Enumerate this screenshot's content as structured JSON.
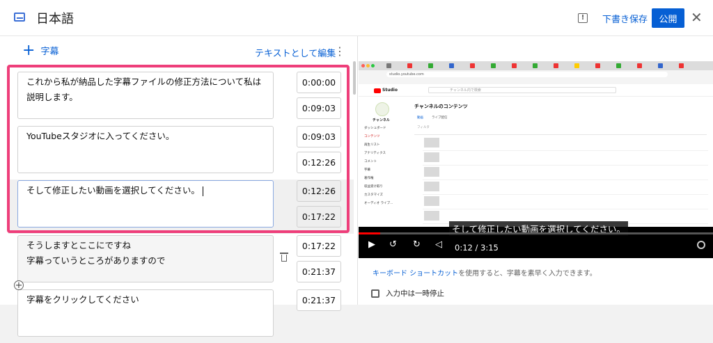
{
  "header": {
    "title": "日本語",
    "draft_label": "下書き保存",
    "publish_label": "公開",
    "close_glyph": "✕",
    "feedback_glyph": "!"
  },
  "editor": {
    "add_subtitle_label": "字幕",
    "edit_as_text_label": "テキストとして編集",
    "more_glyph": "⋮",
    "rows": [
      {
        "text": "これから私が納品した字幕ファイルの修正方法について私は説明します。",
        "start": "0:00:00",
        "end": "0:09:03"
      },
      {
        "text": "YouTubeスタジオに入ってください。",
        "start": "0:09:03",
        "end": "0:12:26"
      },
      {
        "text": "そして修正したい動画を選択してください。",
        "start": "0:12:26",
        "end": "0:17:22"
      },
      {
        "text": "そうしますとここにですね\n字幕っていうところがありますので",
        "start": "0:17:22",
        "end": "0:21:37"
      },
      {
        "text": "字幕をクリックしてください",
        "start": "0:21:37",
        "end": ""
      }
    ]
  },
  "preview": {
    "caption": "そして修正したい動画を選択してください。",
    "time_current": "0:12",
    "time_total": "3:15",
    "progress": 0.06,
    "studio": {
      "logo_text": "Studio",
      "search_placeholder": "チャンネル内で検索",
      "page_title": "チャンネルのコンテンツ",
      "tab_uploads": "動画",
      "tab_live": "ライブ配信",
      "filter_label": "フィルタ",
      "channel_label": "チャンネル",
      "sidebar": [
        "ダッシュボード",
        "コンテンツ",
        "再生リスト",
        "アナリティクス",
        "コメント",
        "字幕",
        "著作権",
        "収益受け取り",
        "カスタマイズ",
        "オーディオ ライブ..."
      ]
    }
  },
  "footer": {
    "shortcut_link": "キーボード ショートカット",
    "shortcut_rest": "を使用すると、字幕を素早く入力できます。",
    "pause_label": "入力中は一時停止"
  },
  "colors": {
    "accent": "#065fd4",
    "highlight": "#ee3e7a"
  }
}
